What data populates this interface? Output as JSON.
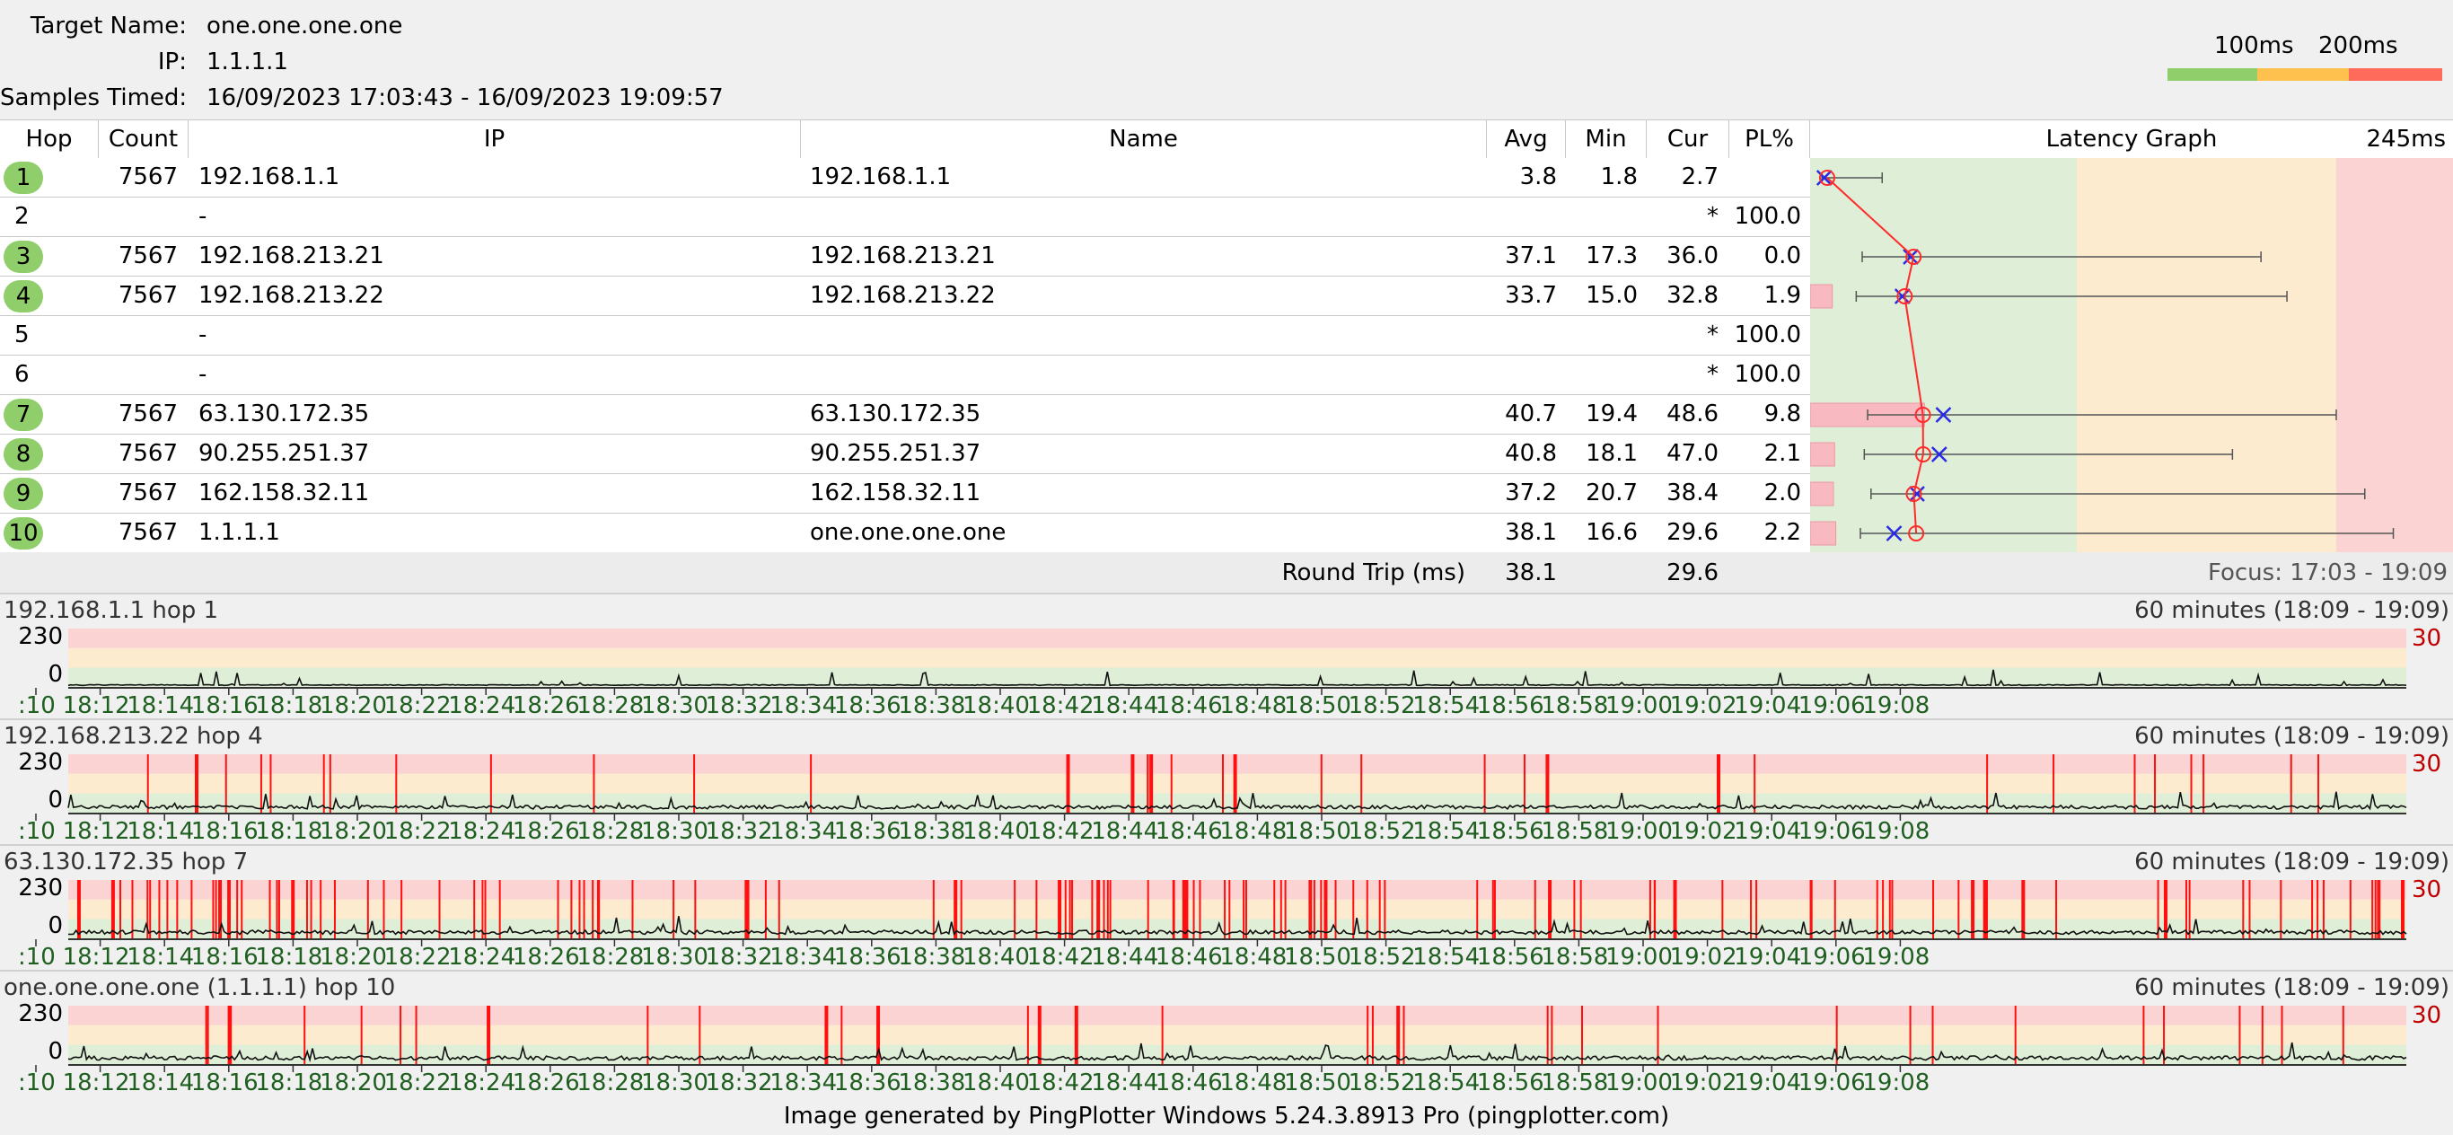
{
  "target": {
    "name_label": "Target Name:",
    "name_value": "one.one.one.one",
    "ip_label": "IP:",
    "ip_value": "1.1.1.1",
    "samples_label": "Samples Timed:",
    "samples_value": "16/09/2023 17:03:43 - 16/09/2023 19:09:57"
  },
  "scale": {
    "label_100": "100ms",
    "label_200": "200ms",
    "colors": {
      "good": "#8fce6a",
      "warn": "#ffc14d",
      "bad": "#ff6b5b"
    }
  },
  "table": {
    "headers": {
      "hop": "Hop",
      "count": "Count",
      "ip": "IP",
      "name": "Name",
      "avg": "Avg",
      "min": "Min",
      "cur": "Cur",
      "pl": "PL%",
      "graph": "Latency Graph",
      "graph_max": "245ms"
    },
    "rows": [
      {
        "hop": "1",
        "badge": true,
        "count": "7567",
        "ip": "192.168.1.1",
        "name": "192.168.1.1",
        "avg": "3.8",
        "min": "1.8",
        "cur": "2.7",
        "pl": "",
        "loss": 0.0,
        "avg_ms": 3.8,
        "min_ms": 1.8,
        "max_ms": 25,
        "cur_ms": 2.7
      },
      {
        "hop": "2",
        "badge": false,
        "count": "",
        "ip": "-",
        "name": "",
        "avg": "",
        "min": "",
        "cur": "*",
        "pl": "100.0",
        "loss": 100.0
      },
      {
        "hop": "3",
        "badge": true,
        "count": "7567",
        "ip": "192.168.213.21",
        "name": "192.168.213.21",
        "avg": "37.1",
        "min": "17.3",
        "cur": "36.0",
        "pl": "0.0",
        "loss": 0.0,
        "avg_ms": 37.1,
        "min_ms": 17.3,
        "max_ms": 171,
        "cur_ms": 36.0
      },
      {
        "hop": "4",
        "badge": true,
        "count": "7567",
        "ip": "192.168.213.22",
        "name": "192.168.213.22",
        "avg": "33.7",
        "min": "15.0",
        "cur": "32.8",
        "pl": "1.9",
        "loss": 1.9,
        "avg_ms": 33.7,
        "min_ms": 15.0,
        "max_ms": 181,
        "cur_ms": 32.8
      },
      {
        "hop": "5",
        "badge": false,
        "count": "",
        "ip": "-",
        "name": "",
        "avg": "",
        "min": "",
        "cur": "*",
        "pl": "100.0",
        "loss": 100.0
      },
      {
        "hop": "6",
        "badge": false,
        "count": "",
        "ip": "-",
        "name": "",
        "avg": "",
        "min": "",
        "cur": "*",
        "pl": "100.0",
        "loss": 100.0
      },
      {
        "hop": "7",
        "badge": true,
        "count": "7567",
        "ip": "63.130.172.35",
        "name": "63.130.172.35",
        "avg": "40.7",
        "min": "19.4",
        "cur": "48.6",
        "pl": "9.8",
        "loss": 9.8,
        "avg_ms": 40.7,
        "min_ms": 19.4,
        "max_ms": 200,
        "cur_ms": 48.6
      },
      {
        "hop": "8",
        "badge": true,
        "count": "7567",
        "ip": "90.255.251.37",
        "name": "90.255.251.37",
        "avg": "40.8",
        "min": "18.1",
        "cur": "47.0",
        "pl": "2.1",
        "loss": 2.1,
        "avg_ms": 40.8,
        "min_ms": 18.1,
        "max_ms": 160,
        "cur_ms": 47.0
      },
      {
        "hop": "9",
        "badge": true,
        "count": "7567",
        "ip": "162.158.32.11",
        "name": "162.158.32.11",
        "avg": "37.2",
        "min": "20.7",
        "cur": "38.4",
        "pl": "2.0",
        "loss": 2.0,
        "avg_ms": 37.2,
        "min_ms": 20.7,
        "max_ms": 211,
        "cur_ms": 38.4
      },
      {
        "hop": "10",
        "badge": true,
        "count": "7567",
        "ip": "1.1.1.1",
        "name": "one.one.one.one",
        "avg": "38.1",
        "min": "16.6",
        "cur": "29.6",
        "pl": "2.2",
        "loss": 2.2,
        "avg_ms": 38.1,
        "min_ms": 16.6,
        "max_ms": 222,
        "cur_ms": 29.6
      }
    ],
    "round_trip": {
      "label": "Round Trip (ms)",
      "avg": "38.1",
      "cur": "29.6"
    },
    "focus": "Focus: 17:03 - 19:09"
  },
  "graph": {
    "max_ms": 245,
    "zones_ms": [
      100,
      200
    ],
    "colors": {
      "good": "#dfeed6",
      "warn": "#fdebcf",
      "bad": "#fbd3d3",
      "line": "#ff2a2a",
      "cross": "#2a2ae6"
    }
  },
  "minis": [
    {
      "title": "192.168.1.1 hop 1",
      "range": "60 minutes (18:09 - 19:09)",
      "y_top": "230",
      "y_bottom": "0",
      "right_label": "30",
      "loss_density": 0,
      "base": 4,
      "seed": 3
    },
    {
      "title": "192.168.213.22 hop 4",
      "range": "60 minutes (18:09 - 19:09)",
      "y_top": "230",
      "y_bottom": "0",
      "right_label": "30",
      "loss_density": 0.06,
      "base": 18,
      "seed": 7
    },
    {
      "title": "63.130.172.35 hop 7",
      "range": "60 minutes (18:09 - 19:09)",
      "y_top": "230",
      "y_bottom": "0",
      "right_label": "30",
      "loss_density": 0.22,
      "base": 20,
      "seed": 11
    },
    {
      "title": "one.one.one.one (1.1.1.1) hop 10",
      "range": "60 minutes (18:09 - 19:09)",
      "y_top": "230",
      "y_bottom": "0",
      "right_label": "30",
      "loss_density": 0.06,
      "base": 20,
      "seed": 19
    }
  ],
  "time_ticks": [
    ":10",
    "18:12",
    "18:14",
    "18:16",
    "18:18",
    "18:20",
    "18:22",
    "18:24",
    "18:26",
    "18:28",
    "18:30",
    "18:32",
    "18:34",
    "18:36",
    "18:38",
    "18:40",
    "18:42",
    "18:44",
    "18:46",
    "18:48",
    "18:50",
    "18:52",
    "18:54",
    "18:56",
    "18:58",
    "19:00",
    "19:02",
    "19:04",
    "19:06",
    "19:08"
  ],
  "footer": "Image generated by PingPlotter Windows 5.24.3.8913 Pro (pingplotter.com)"
}
